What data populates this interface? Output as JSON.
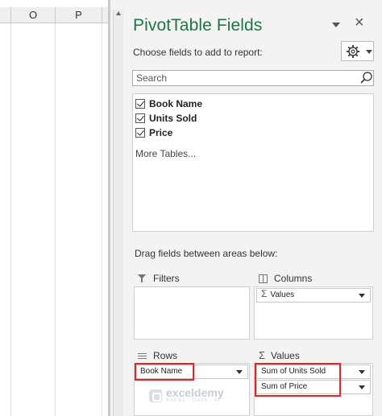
{
  "sheet": {
    "columns": [
      "O",
      "P"
    ]
  },
  "pane": {
    "title": "PivotTable Fields",
    "choose_label": "Choose fields to add to report:",
    "search_placeholder": "Search",
    "fields": [
      {
        "label": "Book Name",
        "checked": true
      },
      {
        "label": "Units Sold",
        "checked": true
      },
      {
        "label": "Price",
        "checked": true
      }
    ],
    "more_tables": "More Tables...",
    "drag_label": "Drag fields between areas below:",
    "areas": {
      "filters": {
        "title": "Filters",
        "items": []
      },
      "columns": {
        "title": "Columns",
        "items": [
          "Values"
        ]
      },
      "rows": {
        "title": "Rows",
        "items": [
          "Book Name"
        ]
      },
      "values": {
        "title": "Values",
        "items": [
          "Sum of Units Sold",
          "Sum of Price"
        ]
      }
    }
  },
  "icons": {
    "gear": "gear-icon",
    "search": "search-icon",
    "close": "close-icon"
  },
  "colors": {
    "title_green": "#217346",
    "highlight_red": "#e0262b"
  },
  "watermark": {
    "name": "exceldemy",
    "tagline": "EXCEL · DATA · BI"
  }
}
